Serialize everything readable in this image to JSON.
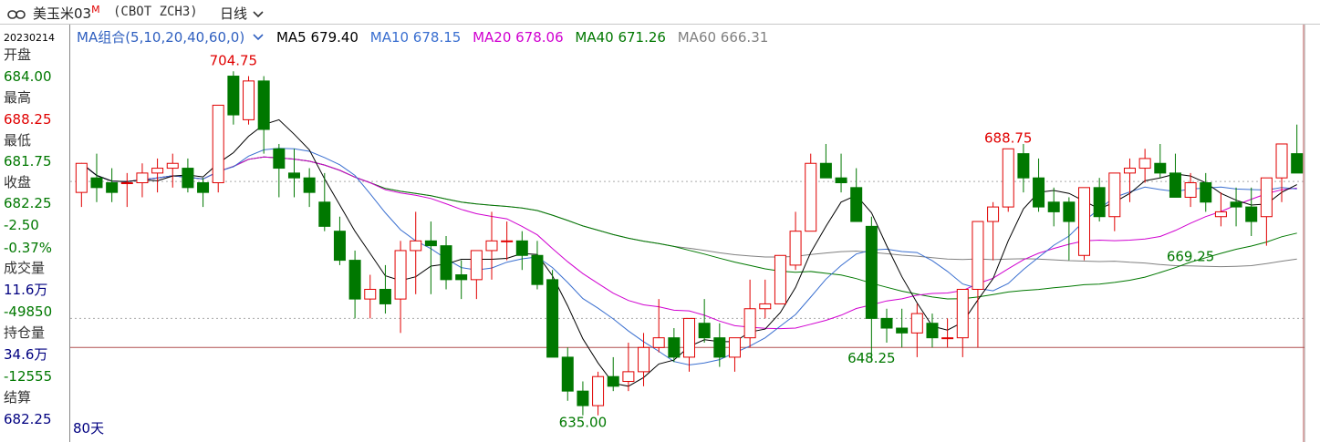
{
  "header": {
    "symbol_name": "美玉米03",
    "symbol_mark": "M",
    "code": "(CBOT ZCH3)",
    "period": "日线"
  },
  "info_panel": {
    "date": "20230214",
    "open_label": "开盘",
    "open": "684.00",
    "high_label": "最高",
    "high": "688.25",
    "low_label": "最低",
    "low": "681.75",
    "close_label": "收盘",
    "close": "682.25",
    "change": "-2.50",
    "change_pct": "-0.37%",
    "volume_label": "成交量",
    "volume": "11.6万",
    "volume_change": "-49850",
    "oi_label": "持仓量",
    "oi": "34.6万",
    "oi_change": "-12555",
    "settle_label": "结算",
    "settle": "682.25"
  },
  "legend": {
    "ma_combo": "MA组合(5,10,20,40,60,0)",
    "ma5": "MA5 679.40",
    "ma10": "MA10 678.15",
    "ma20": "MA20 678.06",
    "ma40": "MA40 671.26",
    "ma60": "MA60 666.31"
  },
  "days_label": "80天",
  "colors": {
    "up": "#e00000",
    "down": "#007800",
    "ma5": "#000000",
    "ma10": "#3a6fd0",
    "ma20": "#d000d0",
    "ma40": "#007800",
    "ma60": "#808080"
  },
  "chart_data": {
    "type": "candlestick",
    "y_range": [
      630,
      712
    ],
    "reference_price": 654,
    "last_price_line": 682.25,
    "annotations": {
      "high_label": "704.75",
      "low_label": "635.00",
      "peak2_label": "688.75",
      "trough2_label": "648.25",
      "low3_label": "669.25"
    },
    "candles": [
      [
        680,
        686,
        677,
        686
      ],
      [
        683,
        688,
        678,
        681
      ],
      [
        682,
        685,
        678,
        680
      ],
      [
        682,
        684,
        677,
        682
      ],
      [
        682,
        686,
        679,
        684
      ],
      [
        684,
        687,
        680,
        685
      ],
      [
        685,
        688,
        681,
        686
      ],
      [
        685,
        687,
        680,
        681
      ],
      [
        682,
        683,
        677,
        680
      ],
      [
        682,
        690,
        680,
        698
      ],
      [
        704,
        705,
        694,
        696
      ],
      [
        695,
        704,
        694,
        703
      ],
      [
        703,
        704,
        688,
        693
      ],
      [
        689,
        690,
        679,
        685
      ],
      [
        684,
        689,
        679,
        683
      ],
      [
        683,
        685,
        677,
        680
      ],
      [
        678,
        684,
        672,
        673
      ],
      [
        672,
        675,
        665,
        666
      ],
      [
        666,
        668,
        654,
        658
      ],
      [
        658,
        663,
        654,
        660
      ],
      [
        660,
        665,
        655,
        657
      ],
      [
        658,
        670,
        651,
        668
      ],
      [
        668,
        676,
        659,
        670
      ],
      [
        670,
        674,
        659,
        669
      ],
      [
        669,
        671,
        660,
        662
      ],
      [
        663,
        666,
        658,
        662
      ],
      [
        662,
        667,
        658,
        668
      ],
      [
        668,
        676,
        662,
        670
      ],
      [
        670,
        674,
        666,
        670
      ],
      [
        670,
        672,
        664,
        667
      ],
      [
        667,
        670,
        660,
        661
      ],
      [
        662,
        664,
        652,
        646
      ],
      [
        646,
        648,
        637,
        639
      ],
      [
        639,
        641,
        634,
        636
      ],
      [
        636,
        643,
        634,
        642
      ],
      [
        642,
        646,
        639,
        640
      ],
      [
        641,
        649,
        639,
        643
      ],
      [
        643,
        651,
        640,
        648
      ],
      [
        648,
        658,
        647,
        650
      ],
      [
        650,
        652,
        645,
        646
      ],
      [
        646,
        653,
        643,
        654
      ],
      [
        653,
        658,
        649,
        650
      ],
      [
        650,
        653,
        644,
        646
      ],
      [
        646,
        649,
        643,
        650
      ],
      [
        650,
        662,
        648,
        656
      ],
      [
        656,
        662,
        654,
        657
      ],
      [
        657,
        667,
        657,
        667
      ],
      [
        665,
        676,
        664,
        672
      ],
      [
        672,
        688,
        672,
        686
      ],
      [
        686,
        690,
        683,
        683
      ],
      [
        683,
        688,
        680,
        682
      ],
      [
        681,
        685,
        676,
        674
      ],
      [
        673,
        675,
        645,
        654
      ],
      [
        654,
        656,
        649,
        652
      ],
      [
        652,
        656,
        648,
        651
      ],
      [
        651,
        657,
        646,
        655
      ],
      [
        653,
        655,
        648,
        650
      ],
      [
        650,
        654,
        648,
        650
      ],
      [
        650,
        654,
        646,
        660
      ],
      [
        660,
        674,
        648,
        674
      ],
      [
        674,
        678,
        666,
        677
      ],
      [
        677,
        689,
        676,
        689
      ],
      [
        688,
        690,
        680,
        683
      ],
      [
        683,
        687,
        676,
        677
      ],
      [
        678,
        681,
        673,
        676
      ],
      [
        678,
        679,
        666,
        674
      ],
      [
        667,
        680,
        666,
        681
      ],
      [
        681,
        683,
        674,
        675
      ],
      [
        675,
        684,
        672,
        684
      ],
      [
        684,
        687,
        678,
        685
      ],
      [
        685,
        689,
        682,
        687
      ],
      [
        686,
        690,
        683,
        684
      ],
      [
        684,
        688,
        680,
        679
      ],
      [
        679,
        684,
        677,
        682
      ],
      [
        682,
        684,
        676,
        678
      ],
      [
        675,
        680,
        673,
        676
      ],
      [
        678,
        681,
        673,
        677
      ],
      [
        677,
        681,
        671,
        674
      ],
      [
        675,
        682,
        669,
        683
      ],
      [
        683,
        690,
        678,
        690
      ],
      [
        688,
        694,
        685,
        684
      ]
    ]
  }
}
